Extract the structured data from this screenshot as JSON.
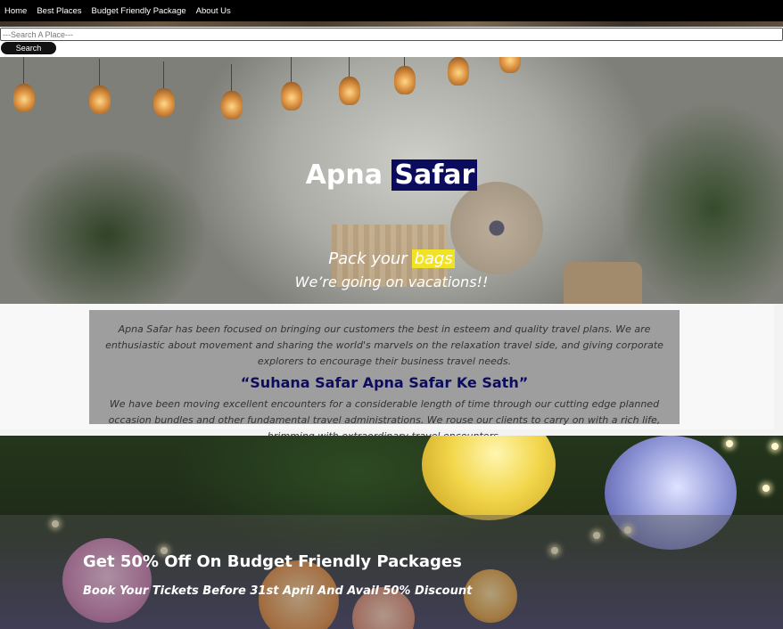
{
  "nav": {
    "items": [
      "Home",
      "Best Places",
      "Budget Friendly Package",
      "About Us"
    ]
  },
  "search": {
    "placeholder": "---Search A Place---",
    "button_label": "Search"
  },
  "hero": {
    "title_part1": "Apna",
    "title_part2": "Safar",
    "highlight_color": "#0c0c5e",
    "tag_part1": "Pack your",
    "tag_part2": "bags",
    "tag_highlight_color": "#f2e224",
    "subtitle": "We’re going on vacations!!"
  },
  "about": {
    "paragraph1": "Apna Safar has been focused on bringing our customers the best in esteem and quality travel plans. We are enthusiastic about movement and sharing the world's marvels on the relaxation travel side, and giving corporate explorers to encourage their business travel needs.",
    "quote": "“Suhana Safar Apna Safar Ke Sath”",
    "paragraph2": "We have been moving excellent encounters for a considerable length of time through our cutting edge planned occasion bundles and other fundamental travel administrations. We rouse our clients to carry on with a rich life, brimming with extraordinary travel encounters."
  },
  "offer": {
    "title": "Get 50% Off On Budget Friendly Packages",
    "subtitle": "Book Your Tickets Before 31st April And Avail 50% Discount"
  }
}
